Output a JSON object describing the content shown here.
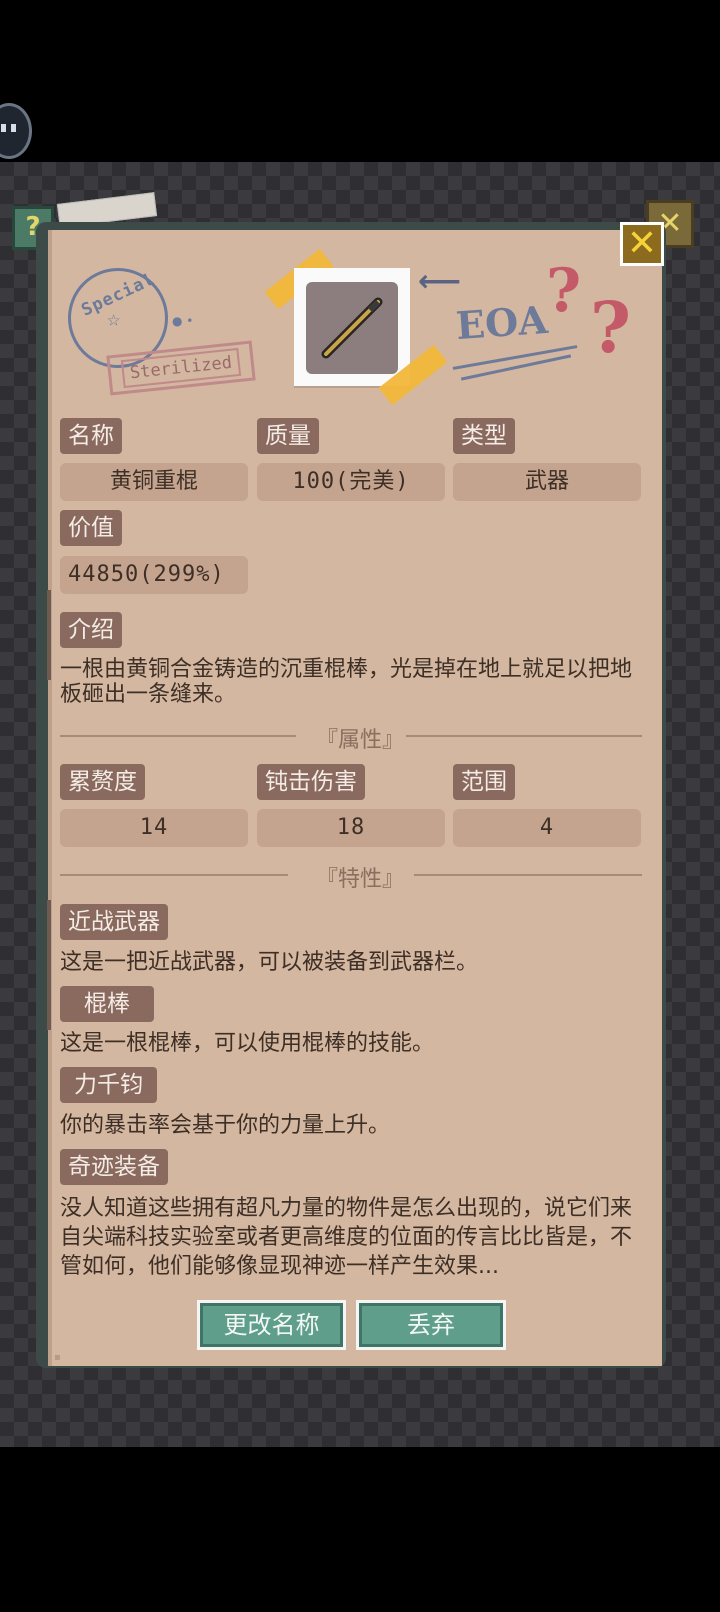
{
  "header": {
    "close_symbol": "✕",
    "help_symbol": "?"
  },
  "stamps": {
    "left_ring_text": "Special",
    "sterilized": "Sterilized",
    "eoa": "EOA",
    "question_marks": "?"
  },
  "stats": {
    "name_label": "名称",
    "name_value": "黄铜重棍",
    "quality_label": "质量",
    "quality_value": "100(完美)",
    "type_label": "类型",
    "type_value": "武器",
    "price_label": "价值",
    "price_value": "44850(299%)"
  },
  "intro": {
    "label": "介绍",
    "text": "一根由黄铜合金铸造的沉重棍棒，光是掉在地上就足以把地板砸出一条缝来。"
  },
  "attributes": {
    "section_title": "『属性』",
    "items": [
      {
        "label": "累赘度",
        "value": "14"
      },
      {
        "label": "钝击伤害",
        "value": "18"
      },
      {
        "label": "范围",
        "value": "4"
      }
    ]
  },
  "traits": {
    "section_title": "『特性』",
    "items": [
      {
        "label": "近战武器",
        "text": "这是一把近战武器，可以被装备到武器栏。"
      },
      {
        "label": "棍棒",
        "text": "这是一根棍棒，可以使用棍棒的技能。"
      },
      {
        "label": "力千钧",
        "text": "你的暴击率会基于你的力量上升。"
      },
      {
        "label": "奇迹装备",
        "text": "没人知道这些拥有超凡力量的物件是怎么出现的，说它们来自尖端科技实验室或者更高维度的位面的传言比比皆是，不管如何，他们能够像显现神迹一样产生效果..."
      }
    ]
  },
  "actions": {
    "rename": "更改名称",
    "discard": "丢弃"
  },
  "colors": {
    "card_bg": "#d3b7a0",
    "label_bg": "#8a6a5e",
    "value_bg": "#c4a48f",
    "button_bg": "#5f9e8a",
    "close_bg": "#8c6a1e"
  }
}
